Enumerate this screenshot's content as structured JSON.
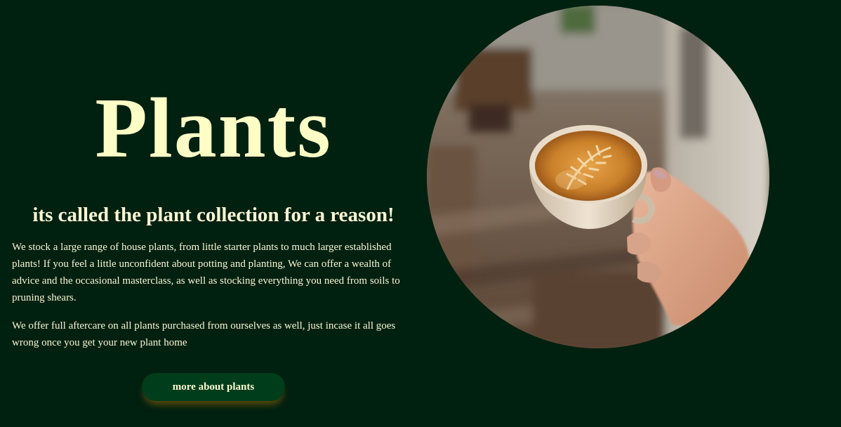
{
  "hero": {
    "title": "Plants",
    "subtitle": "its called the plant collection for a reason!",
    "paragraphs": [
      "We stock a large range of house plants, from little starter plants to much larger established plants! If you feel a little unconfident about potting and planting, We can offer a wealth of advice and the occasional masterclass, as well as stocking everything you need from soils to pruning shears.",
      "We offer full aftercare on all plants purchased from ourselves as well, just incase it all goes wrong once you get your new plant home"
    ],
    "button_label": "more about plants"
  },
  "colors": {
    "background": "#002010",
    "text": "#fdf8d2",
    "button": "#003d1a",
    "button_shadow": "#785a0a"
  }
}
